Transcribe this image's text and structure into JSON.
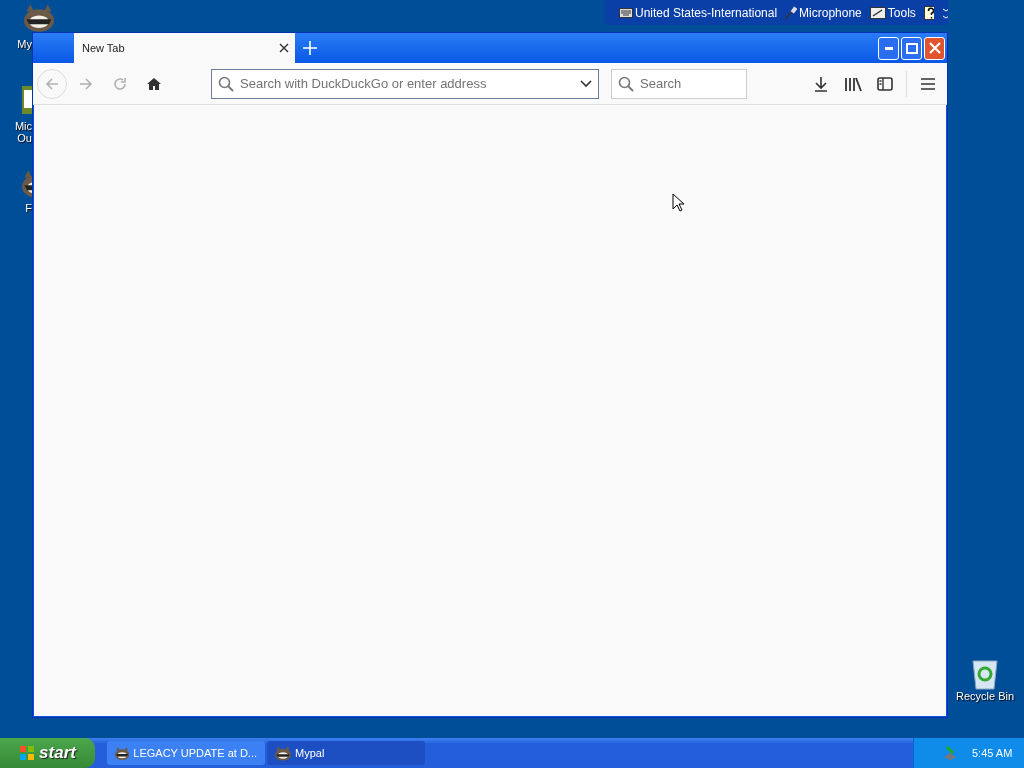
{
  "desktop_icons": [
    {
      "kind": "raccoon",
      "lines": [
        "My"
      ]
    },
    {
      "kind": "mail",
      "lines": [
        "Mic",
        "Ou"
      ]
    },
    {
      "kind": "raccoon",
      "lines": [
        "F"
      ]
    },
    {
      "kind": "recycle",
      "lines": [
        "Recycle Bin"
      ]
    }
  ],
  "language_bar": {
    "items": [
      {
        "kind": "keyboard",
        "label": "United States-International"
      },
      {
        "kind": "mic",
        "label": "Microphone"
      },
      {
        "kind": "tools",
        "label": "Tools"
      }
    ]
  },
  "browser": {
    "tabs": [
      {
        "title": "New Tab",
        "selected": true
      }
    ],
    "nav": [
      {
        "kind": "back",
        "disabled": true
      },
      {
        "kind": "forward",
        "disabled": true
      },
      {
        "kind": "reload",
        "disabled": true
      },
      {
        "kind": "home",
        "disabled": false
      }
    ],
    "address_bar": {
      "placeholder": "Search with DuckDuckGo or enter address"
    },
    "search_box": {
      "placeholder": "Search"
    }
  },
  "taskbar": {
    "start": "start",
    "tasks": [
      {
        "label": "LEGACY UPDATE at D...",
        "selected": false
      },
      {
        "label": "Mypal",
        "selected": true
      }
    ],
    "clock": "5:45 AM"
  }
}
